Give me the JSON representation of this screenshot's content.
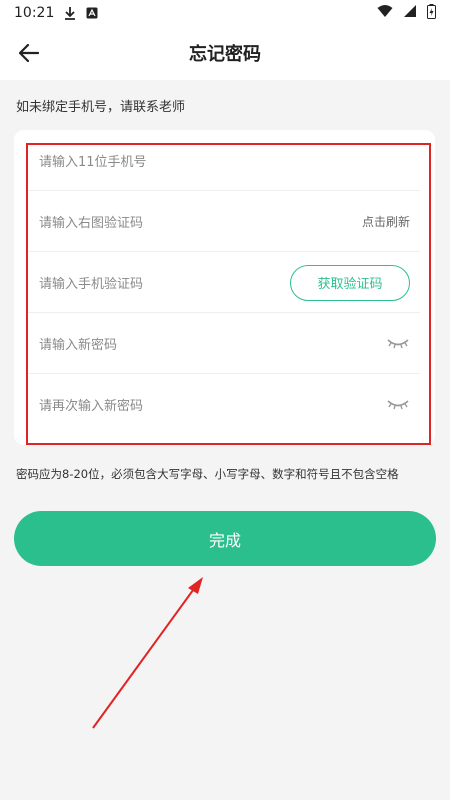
{
  "status_bar": {
    "time": "10:21",
    "icons": [
      "download-icon",
      "a-icon",
      "wifi-icon",
      "signal-icon",
      "battery-icon"
    ]
  },
  "header": {
    "title": "忘记密码",
    "back_icon": "arrow-left-icon"
  },
  "hint_top": "如未绑定手机号，请联系老师",
  "form": {
    "phone_placeholder": "请输入11位手机号",
    "captcha_placeholder": "请输入右图验证码",
    "captcha_refresh": "点击刷新",
    "sms_placeholder": "请输入手机验证码",
    "get_code_label": "获取验证码",
    "new_password_placeholder": "请输入新密码",
    "confirm_password_placeholder": "请再次输入新密码",
    "eye_icon": "eye-closed-icon"
  },
  "password_rule": "密码应为8-20位，必须包含大写字母、小写字母、数字和符号且不包含空格",
  "done_label": "完成",
  "colors": {
    "accent": "#2bbf8e",
    "highlight": "#e02424",
    "background": "#f4f4f4"
  }
}
